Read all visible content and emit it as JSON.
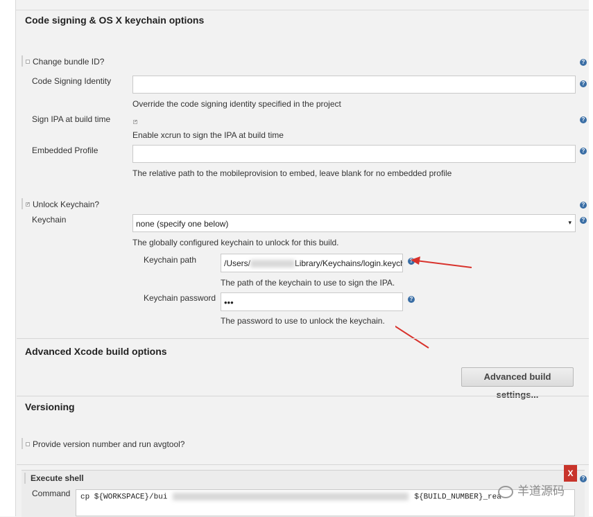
{
  "codesign": {
    "title": "Code signing & OS X keychain options",
    "change_bundle_label": "Change bundle ID?",
    "code_signing_identity_label": "Code Signing Identity",
    "code_signing_identity_value": "",
    "code_signing_identity_desc": "Override the code signing identity specified in the project",
    "sign_ipa_label": "Sign IPA at build time",
    "sign_ipa_desc": "Enable xcrun to sign the IPA at build time",
    "embedded_profile_label": "Embedded Profile",
    "embedded_profile_value": "",
    "embedded_profile_desc": "The relative path to the mobileprovision to embed, leave blank for no embedded profile",
    "unlock_keychain_label": "Unlock Keychain?",
    "keychain_label": "Keychain",
    "keychain_selected": "none (specify one below)",
    "keychain_desc": "The globally configured keychain to unlock for this build.",
    "keychain_path_label": "Keychain path",
    "keychain_path_prefix": "/Users/",
    "keychain_path_suffix": "Library/Keychains/login.keych",
    "keychain_path_desc": "The path of the keychain to use to sign the IPA.",
    "keychain_password_label": "Keychain password",
    "keychain_password_value": "•••",
    "keychain_password_desc": "The password to use to unlock the keychain."
  },
  "advanced": {
    "title": "Advanced Xcode build options",
    "button_label": "Advanced build settings..."
  },
  "versioning": {
    "title": "Versioning",
    "avgtool_label": "Provide version number and run avgtool?"
  },
  "shell": {
    "title": "Execute shell",
    "command_label": "Command",
    "command_start": "cp ${WORKSPACE}/bui",
    "command_mid": "${BUILD_NUMBER}_rea",
    "delete_label": "X"
  },
  "watermark": {
    "text": "羊道源码"
  },
  "colors": {
    "annotation_arrow": "#d8322c",
    "help_icon": "#3a6ea5",
    "delete_button": "#c8342b"
  }
}
